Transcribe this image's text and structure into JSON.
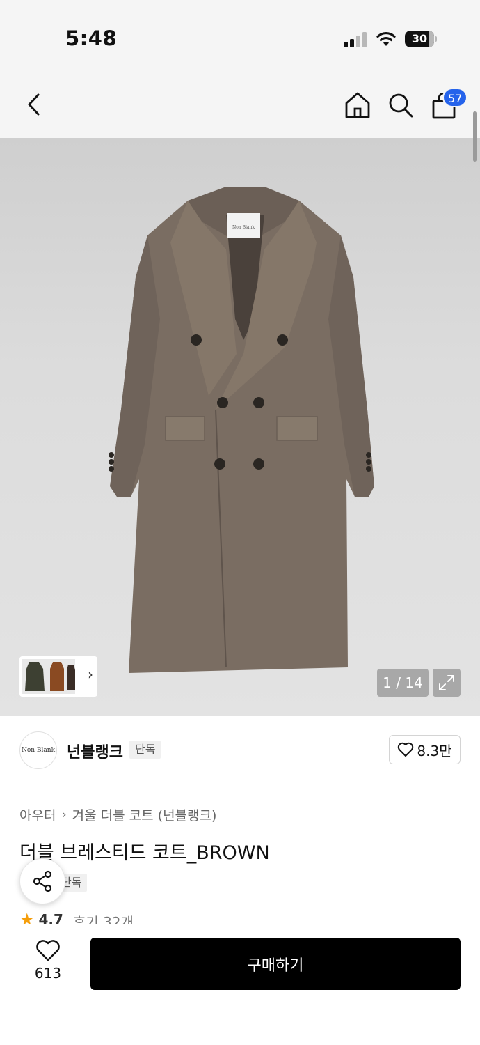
{
  "status_bar": {
    "time": "5:48",
    "battery": "30"
  },
  "nav": {
    "cart_count": "57"
  },
  "gallery": {
    "counter": "1 / 14"
  },
  "brand": {
    "logo_text": "Non Blank",
    "name": "넌블랭크",
    "tag": "단독",
    "likes": "8.3만"
  },
  "product": {
    "breadcrumb": [
      "아우터",
      "겨울 더블 코트 (넌블랭크)"
    ],
    "title": "더블 브레스티드 코트_BROWN",
    "exclusive_tag": "단독",
    "rating": "4.7",
    "reviews": "후기 32개"
  },
  "bottom_bar": {
    "wish_count": "613",
    "buy_label": "구매하기"
  },
  "colors": {
    "accent_badge": "#2563eb",
    "buy_button": "#000000",
    "star": "#f59e0b",
    "coat": "#7a6d62"
  }
}
